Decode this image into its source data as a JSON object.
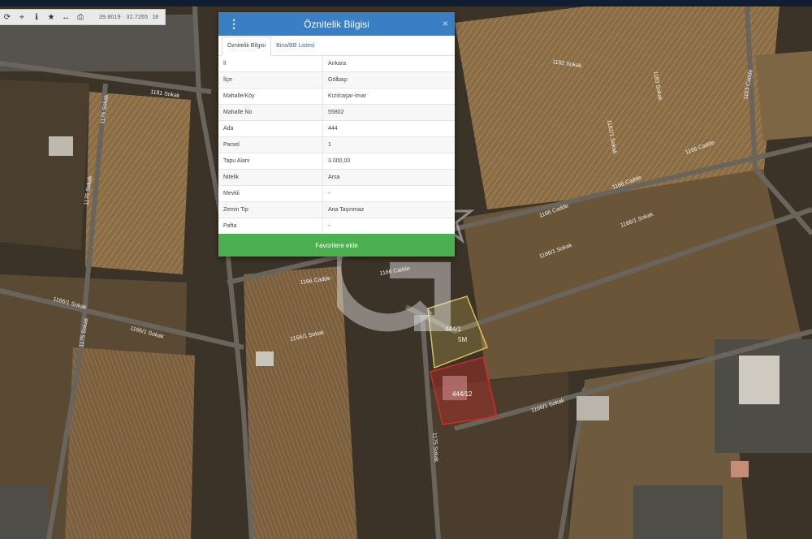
{
  "toolbar": {
    "icons": [
      "refresh-icon",
      "locate-icon",
      "info-icon",
      "star-icon",
      "measure-icon",
      "print-icon"
    ],
    "coords": "39.8019 · 32.7265",
    "zoom": "18"
  },
  "panel": {
    "title": "Öznitelik Bilgisi",
    "close": "×",
    "menu": "⋮",
    "tabs": [
      {
        "label": "Öznitelik Bilgisi",
        "active": true
      },
      {
        "label": "Bina/BB Listesi",
        "active": false
      }
    ],
    "rows": [
      {
        "key": "İl",
        "value": "Ankara"
      },
      {
        "key": "İlçe",
        "value": "Gölbaşı"
      },
      {
        "key": "Mahalle/Köy",
        "value": "Kızılcaşar-İmar"
      },
      {
        "key": "Mahalle No",
        "value": "55802"
      },
      {
        "key": "Ada",
        "value": "444"
      },
      {
        "key": "Parsel",
        "value": "1"
      },
      {
        "key": "Tapu Alanı",
        "value": "3.000,00"
      },
      {
        "key": "Nitelik",
        "value": "Arsa"
      },
      {
        "key": "Mevkii",
        "value": "-"
      },
      {
        "key": "Zemin Tip",
        "value": "Ana Taşınmaz"
      },
      {
        "key": "Pafta",
        "value": "-"
      }
    ],
    "favorite_button": "Favorilere ekle"
  },
  "map": {
    "road_labels": [
      "1181 Sokak",
      "1176 Sokak",
      "1175 Sokak",
      "1166 Cadde",
      "1166 Cadde",
      "1166 Cadde",
      "1166 Cadde",
      "1166/1 Sokak",
      "1166/1 Sokak",
      "1166/1 Sokak",
      "1166/1 Sokak",
      "1166/1 Sokak",
      "1166/1 Sokak",
      "1182 Sokak",
      "1182/1 Sokak",
      "1183 Sokak",
      "1163 Cadde",
      "1175 Sokak",
      "1175 Sokak"
    ],
    "parcels": [
      {
        "label": "444/1",
        "color": "#d8c060"
      },
      {
        "label": "444/1/2",
        "color": "#d02a2a"
      }
    ],
    "parcel_marker": "5M",
    "selected_parcel": "444/12"
  },
  "colors": {
    "header": "#3a7fc3",
    "favorite": "#4caf50",
    "selected": "#d02a2a",
    "neighbor": "#d8c060"
  }
}
